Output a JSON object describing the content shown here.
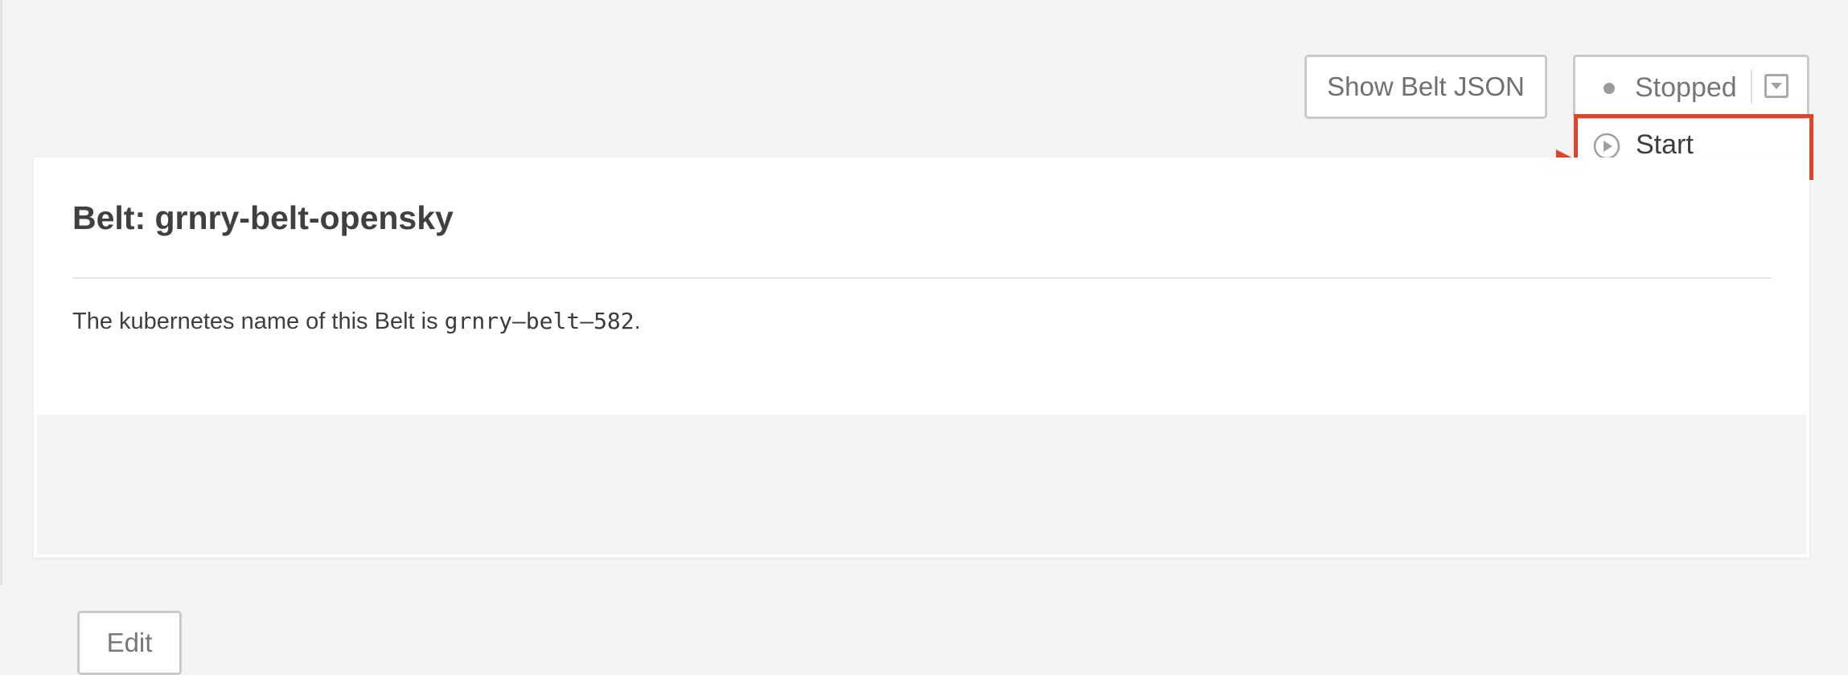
{
  "toolbar": {
    "show_json_label": "Show Belt JSON",
    "status_label": "Stopped",
    "status_icon": "dot-icon",
    "caret_icon": "chevron-down-icon"
  },
  "dropdown": {
    "items": [
      {
        "label": "Start",
        "icon": "play-circle-icon"
      }
    ]
  },
  "annotation": {
    "highlight_color": "#e0452b"
  },
  "card": {
    "title": "Belt: grnry-belt-opensky",
    "description_prefix": "The kubernetes name of this Belt is ",
    "kubernetes_name": "grnry–belt–582",
    "description_suffix": ".",
    "edit_label": "Edit"
  }
}
